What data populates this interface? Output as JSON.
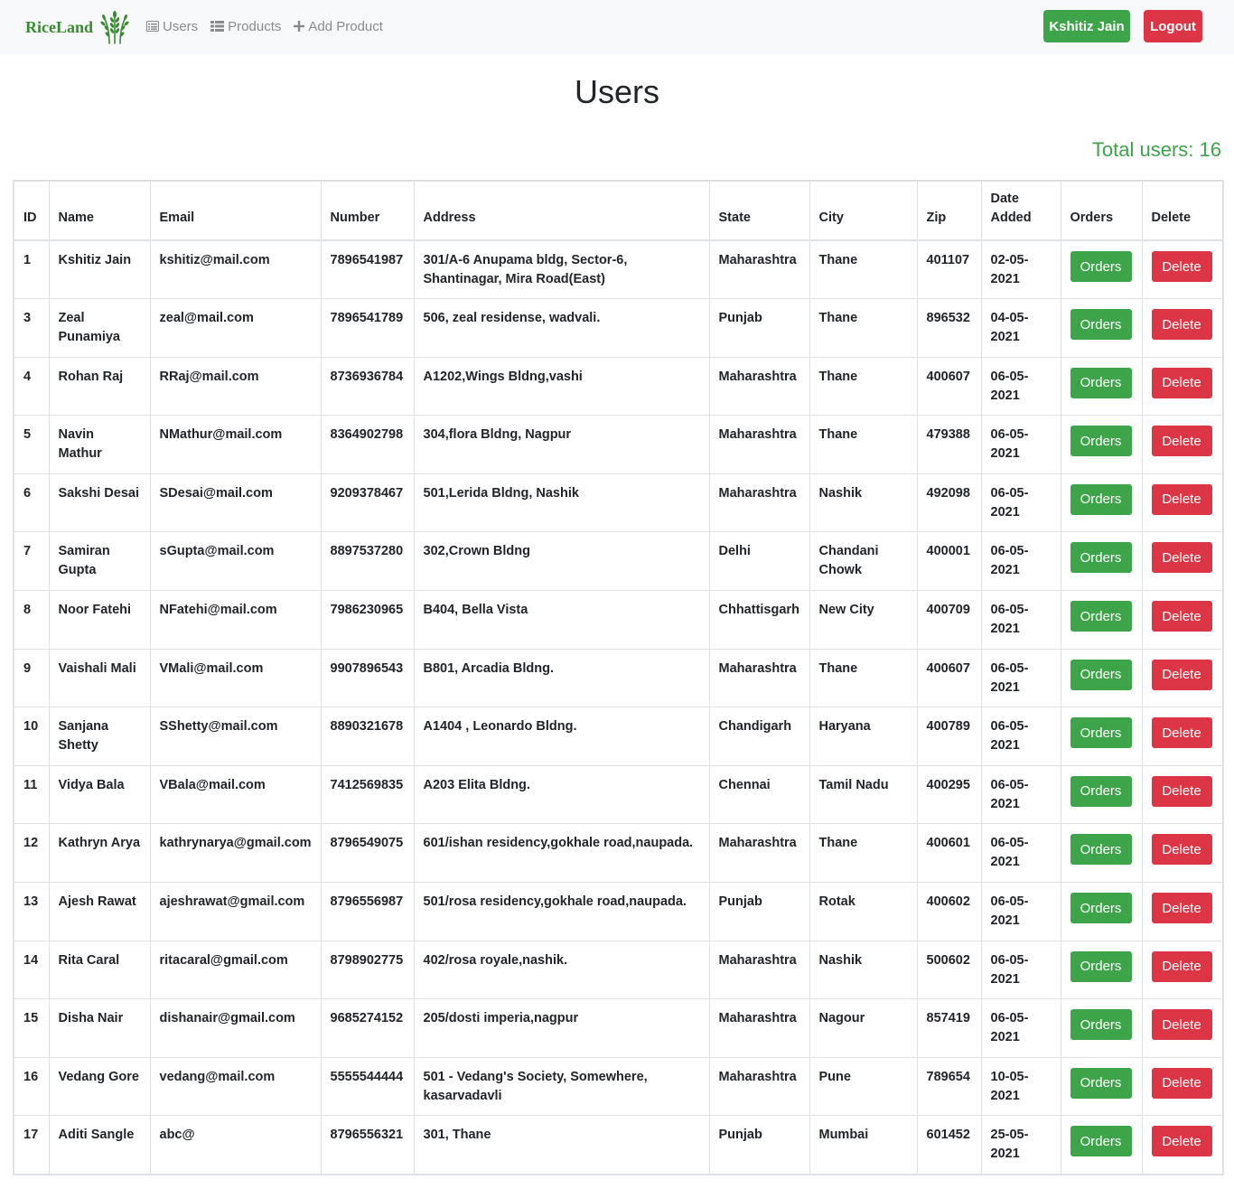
{
  "navbar": {
    "brand": "RiceLand",
    "links": [
      {
        "label": "Users",
        "icon": "list-icon"
      },
      {
        "label": "Products",
        "icon": "table-icon"
      },
      {
        "label": "Add Product",
        "icon": "plus-icon"
      }
    ],
    "user_button": "Kshitiz Jain",
    "logout_button": "Logout"
  },
  "page": {
    "title": "Users",
    "total_label": "Total users: 16"
  },
  "colors": {
    "brand_green": "#3a8a33",
    "success": "#3ea44a",
    "danger": "#dc3545",
    "nav_bg": "#f8f9fa"
  },
  "table": {
    "headers": [
      "ID",
      "Name",
      "Email",
      "Number",
      "Address",
      "State",
      "City",
      "Zip",
      "Date Added",
      "Orders",
      "Delete"
    ],
    "orders_label": "Orders",
    "delete_label": "Delete",
    "rows": [
      {
        "id": "1",
        "name": "Kshitiz Jain",
        "email": "kshitiz@mail.com",
        "number": "7896541987",
        "address": "301/A-6 Anupama bldg, Sector-6, Shantinagar, Mira Road(East)",
        "state": "Maharashtra",
        "city": "Thane",
        "zip": "401107",
        "date": "02-05-2021"
      },
      {
        "id": "3",
        "name": "Zeal Punamiya",
        "email": "zeal@mail.com",
        "number": "7896541789",
        "address": "506, zeal residense, wadvali.",
        "state": "Punjab",
        "city": "Thane",
        "zip": "896532",
        "date": "04-05-2021"
      },
      {
        "id": "4",
        "name": "Rohan Raj",
        "email": "RRaj@mail.com",
        "number": "8736936784",
        "address": "A1202,Wings Bldng,vashi",
        "state": "Maharashtra",
        "city": "Thane",
        "zip": "400607",
        "date": "06-05-2021"
      },
      {
        "id": "5",
        "name": "Navin Mathur",
        "email": "NMathur@mail.com",
        "number": "8364902798",
        "address": "304,flora Bldng, Nagpur",
        "state": "Maharashtra",
        "city": "Thane",
        "zip": "479388",
        "date": "06-05-2021"
      },
      {
        "id": "6",
        "name": "Sakshi Desai",
        "email": "SDesai@mail.com",
        "number": "9209378467",
        "address": "501,Lerida Bldng, Nashik",
        "state": "Maharashtra",
        "city": "Nashik",
        "zip": "492098",
        "date": "06-05-2021"
      },
      {
        "id": "7",
        "name": "Samiran Gupta",
        "email": "sGupta@mail.com",
        "number": "8897537280",
        "address": "302,Crown Bldng",
        "state": "Delhi",
        "city": "Chandani Chowk",
        "zip": "400001",
        "date": "06-05-2021"
      },
      {
        "id": "8",
        "name": "Noor Fatehi",
        "email": "NFatehi@mail.com",
        "number": "7986230965",
        "address": "B404, Bella Vista",
        "state": "Chhattisgarh",
        "city": "New City",
        "zip": "400709",
        "date": "06-05-2021"
      },
      {
        "id": "9",
        "name": "Vaishali Mali",
        "email": "VMali@mail.com",
        "number": "9907896543",
        "address": "B801, Arcadia Bldng.",
        "state": "Maharashtra",
        "city": "Thane",
        "zip": "400607",
        "date": "06-05-2021"
      },
      {
        "id": "10",
        "name": "Sanjana Shetty",
        "email": "SShetty@mail.com",
        "number": "8890321678",
        "address": "A1404 , Leonardo Bldng.",
        "state": "Chandigarh",
        "city": "Haryana",
        "zip": "400789",
        "date": "06-05-2021"
      },
      {
        "id": "11",
        "name": "Vidya Bala",
        "email": "VBala@mail.com",
        "number": "7412569835",
        "address": "A203 Elita Bldng.",
        "state": "Chennai",
        "city": "Tamil Nadu",
        "zip": "400295",
        "date": "06-05-2021"
      },
      {
        "id": "12",
        "name": "Kathryn Arya",
        "email": "kathrynarya@gmail.com",
        "number": "8796549075",
        "address": "601/ishan residency,gokhale road,naupada.",
        "state": "Maharashtra",
        "city": "Thane",
        "zip": "400601",
        "date": "06-05-2021"
      },
      {
        "id": "13",
        "name": "Ajesh Rawat",
        "email": "ajeshrawat@gmail.com",
        "number": "8796556987",
        "address": "501/rosa residency,gokhale road,naupada.",
        "state": "Punjab",
        "city": "Rotak",
        "zip": "400602",
        "date": "06-05-2021"
      },
      {
        "id": "14",
        "name": "Rita Caral",
        "email": "ritacaral@gmail.com",
        "number": "8798902775",
        "address": "402/rosa royale,nashik.",
        "state": "Maharashtra",
        "city": "Nashik",
        "zip": "500602",
        "date": "06-05-2021"
      },
      {
        "id": "15",
        "name": "Disha Nair",
        "email": "dishanair@gmail.com",
        "number": "9685274152",
        "address": "205/dosti imperia,nagpur",
        "state": "Maharashtra",
        "city": "Nagour",
        "zip": "857419",
        "date": "06-05-2021"
      },
      {
        "id": "16",
        "name": "Vedang Gore",
        "email": "vedang@mail.com",
        "number": "5555544444",
        "address": "501 - Vedang's Society, Somewhere, kasarvadavli",
        "state": "Maharashtra",
        "city": "Pune",
        "zip": "789654",
        "date": "10-05-2021"
      },
      {
        "id": "17",
        "name": "Aditi Sangle",
        "email": "abc@",
        "number": "8796556321",
        "address": "301, Thane",
        "state": "Punjab",
        "city": "Mumbai",
        "zip": "601452",
        "date": "25-05-2021"
      }
    ]
  }
}
